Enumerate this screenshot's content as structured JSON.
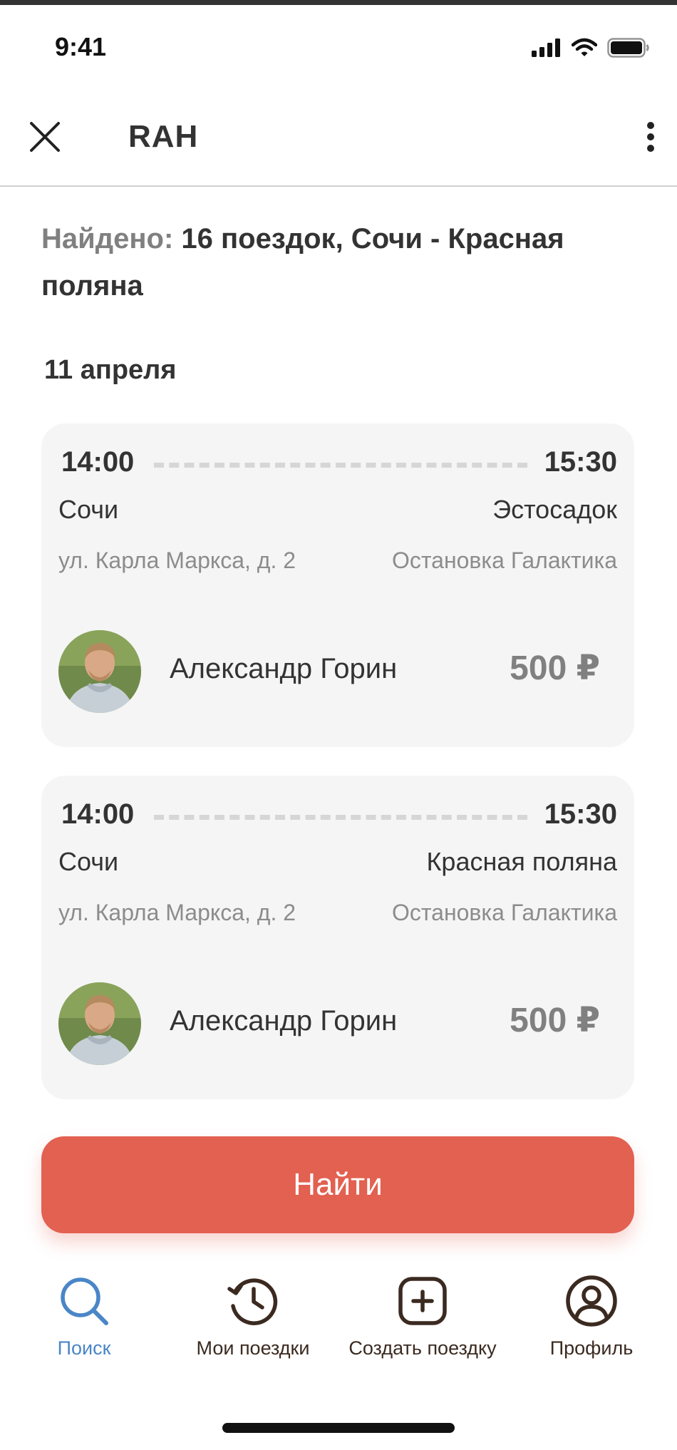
{
  "status_bar": {
    "time": "9:41"
  },
  "header": {
    "title": "RAH"
  },
  "summary": {
    "label": "Найдено:",
    "text": "16 поездок, Сочи - Красная поляна"
  },
  "date_heading": "11 апреля",
  "trips": [
    {
      "departure_time": "14:00",
      "arrival_time": "15:30",
      "from_city": "Сочи",
      "to_city": "Эстосадок",
      "from_address": "ул. Карла Маркса, д. 2",
      "to_address": "Остановка Галактика",
      "driver_name": "Александр Горин",
      "price": "500 ₽"
    },
    {
      "departure_time": "14:00",
      "arrival_time": "15:30",
      "from_city": "Сочи",
      "to_city": "Красная поляна",
      "from_address": "ул. Карла Маркса, д. 2",
      "to_address": "Остановка Галактика",
      "driver_name": "Александр Горин",
      "price": "500 ₽"
    }
  ],
  "find_button_label": "Найти",
  "tabs": [
    {
      "label": "Поиск",
      "icon": "search-icon",
      "active": true
    },
    {
      "label": "Мои поездки",
      "icon": "history-icon",
      "active": false
    },
    {
      "label": "Создать поездку",
      "icon": "add-square-icon",
      "active": false
    },
    {
      "label": "Профиль",
      "icon": "profile-icon",
      "active": false
    }
  ],
  "colors": {
    "accent_button": "#e26150",
    "active_tab": "#4a86c8",
    "tab_icon": "#3b2a20",
    "card_background": "#f5f5f5"
  }
}
